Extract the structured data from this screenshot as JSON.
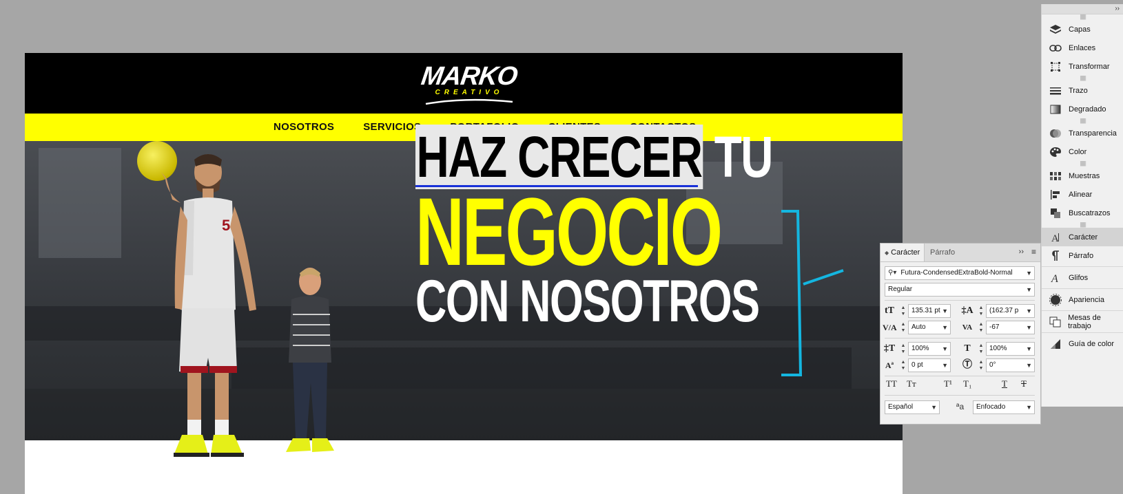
{
  "site": {
    "logo_main": "MARKO",
    "logo_sub": "CREATIVO",
    "nav": [
      "NOSOTROS",
      "SERVICIOS",
      "PORTAFOLIO",
      "CLIENTES",
      "CONTACTOS"
    ]
  },
  "hero": {
    "line1_black": "HAZ CRECER",
    "line1_white": " TU",
    "line2": "NEGOCIO",
    "line3": "CON NOSOTROS",
    "jersey_number": "5"
  },
  "colors": {
    "brand_yellow": "#ffff00",
    "bracket": "#14b6e0",
    "selection_blue": "#1830d8"
  },
  "dock": {
    "items": [
      {
        "label": "Capas",
        "icon": "layers-icon"
      },
      {
        "label": "Enlaces",
        "icon": "links-icon"
      },
      {
        "label": "Transformar",
        "icon": "transform-icon"
      },
      {
        "label": "Trazo",
        "icon": "stroke-icon"
      },
      {
        "label": "Degradado",
        "icon": "gradient-icon"
      },
      {
        "label": "Transparencia",
        "icon": "transparency-icon"
      },
      {
        "label": "Color",
        "icon": "color-icon"
      },
      {
        "label": "Muestras",
        "icon": "swatches-icon"
      },
      {
        "label": "Alinear",
        "icon": "align-icon"
      },
      {
        "label": "Buscatrazos",
        "icon": "pathfinder-icon"
      },
      {
        "label": "Carácter",
        "icon": "character-icon"
      },
      {
        "label": "Párrafo",
        "icon": "paragraph-icon"
      },
      {
        "label": "Glifos",
        "icon": "glyphs-icon"
      },
      {
        "label": "Apariencia",
        "icon": "appearance-icon"
      },
      {
        "label": "Mesas de trabajo",
        "icon": "artboards-icon"
      },
      {
        "label": "Guía de color",
        "icon": "color-guide-icon"
      }
    ]
  },
  "character_panel": {
    "tab_active": "Carácter",
    "tab_inactive": "Párrafo",
    "font_family": "Futura-CondensedExtraBold-Normal",
    "font_style": "Regular",
    "font_size": "135.31 pt",
    "leading": "(162.37 p",
    "kerning": "Auto",
    "tracking": "-67",
    "vertical_scale": "100%",
    "horizontal_scale": "100%",
    "baseline_shift": "0 pt",
    "rotation": "0°",
    "language": "Español",
    "antialiasing": "Enfocado"
  }
}
